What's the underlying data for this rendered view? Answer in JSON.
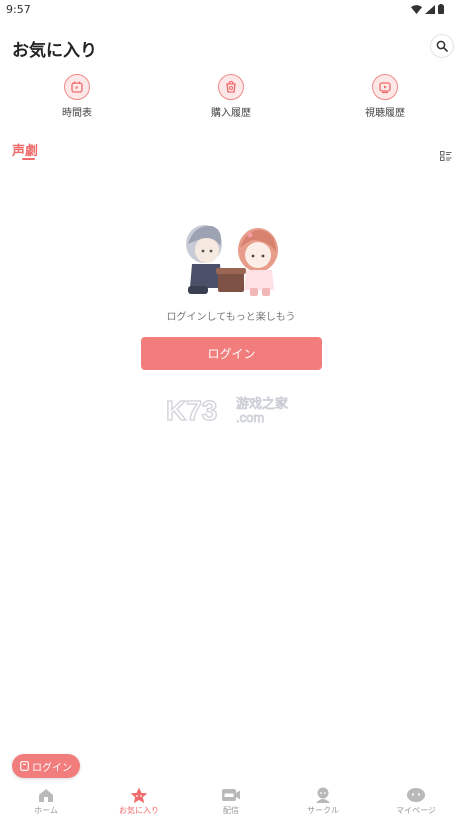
{
  "status_bar": {
    "time": "9:57"
  },
  "header": {
    "title": "お気に入り"
  },
  "shortcuts": [
    {
      "label": "時間表",
      "icon": "timetable-icon"
    },
    {
      "label": "購入履歴",
      "icon": "purchase-history-icon"
    },
    {
      "label": "視聴履歴",
      "icon": "viewing-history-icon"
    }
  ],
  "tabs": {
    "active": "声劇"
  },
  "empty_state": {
    "message": "ログインしてもっと楽しもう",
    "login_button": "ログイン"
  },
  "watermark": {
    "brand": "K73",
    "text_top": "游戏之家",
    "text_bottom": ".com"
  },
  "floating_login": {
    "label": "ログイン"
  },
  "bottom_nav": [
    {
      "label": "ホーム",
      "icon": "home-icon",
      "active": false
    },
    {
      "label": "お気に入り",
      "icon": "star-icon",
      "active": true
    },
    {
      "label": "配信",
      "icon": "live-icon",
      "active": false
    },
    {
      "label": "サークル",
      "icon": "circle-icon",
      "active": false
    },
    {
      "label": "マイページ",
      "icon": "mypage-icon",
      "active": false
    }
  ],
  "colors": {
    "accent": "#ef6b6b",
    "button": "#f27d7d",
    "inactive": "#999999"
  }
}
